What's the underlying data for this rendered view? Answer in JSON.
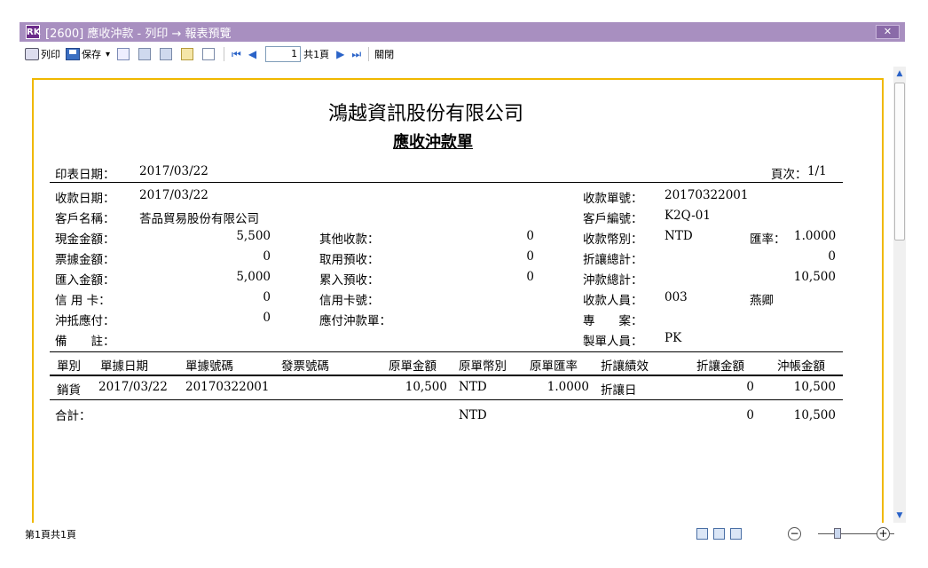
{
  "window": {
    "logo": "RK",
    "title": "[2600] 應收沖款 - 列印 → 報表預覽",
    "close": "✕"
  },
  "toolbar": {
    "print": "列印",
    "save": "保存",
    "save_dropdown": "▾",
    "first": "⏮",
    "prev": "◀",
    "page": "1",
    "page_total": "共1頁",
    "next": "▶",
    "last": "⏭",
    "close": "關閉"
  },
  "report": {
    "company": "鴻越資訊股份有限公司",
    "title": "應收沖款單",
    "print_date_label": "印表日期：",
    "print_date": "2017/03/22",
    "page_label": "頁次：",
    "page": "1/1",
    "fields": {
      "receipt_date_label": "收款日期：",
      "receipt_date": "2017/03/22",
      "receipt_no_label": "收款單號：",
      "receipt_no": "20170322001",
      "customer_label": "客戶名稱：",
      "customer": "荅品貿易股份有限公司",
      "customer_no_label": "客戶編號：",
      "customer_no": "K2Q-01",
      "cash_label": "現金金額：",
      "cash": "5,500",
      "other_label": "其他收款：",
      "other": "0",
      "currency_label": "收款幣別：",
      "currency": "NTD",
      "rate_label": "匯率：",
      "rate": "1.0000",
      "bill_label": "票據金額：",
      "bill": "0",
      "prepay_used_label": "取用預收：",
      "prepay_used": "0",
      "discount_total_label": "折讓總計：",
      "discount_total": "0",
      "remit_label": "匯入金額：",
      "remit": "5,000",
      "prepay_in_label": "累入預收：",
      "prepay_in": "0",
      "offset_total_label": "沖款總計：",
      "offset_total": "10,500",
      "card_label": "信 用 卡：",
      "card": "0",
      "card_no_label": "信用卡號：",
      "collector_label": "收款人員：",
      "collector_id": "003",
      "collector_name": "燕卿",
      "payable_label": "沖抵應付：",
      "payable": "0",
      "payable_no_label": "應付沖款單：",
      "project_label": "專　　案：",
      "note_label": "備　　註：",
      "maker_label": "製單人員：",
      "maker": "PK"
    },
    "columns": [
      "單別",
      "單據日期",
      "單據號碼",
      "發票號碼",
      "原單金額",
      "原單幣別",
      "原單匯率",
      "折讓績效",
      "折讓金額",
      "沖帳金額"
    ],
    "rows": [
      {
        "type": "銷貨",
        "date": "2017/03/22",
        "doc_no": "20170322001",
        "invoice": "",
        "amount": "10,500",
        "currency": "NTD",
        "rate": "1.0000",
        "perf": "折讓日",
        "discount": "0",
        "offset": "10,500"
      }
    ],
    "total": {
      "label": "合計：",
      "currency": "NTD",
      "discount": "0",
      "offset": "10,500"
    }
  },
  "status": {
    "text": "第1頁共1頁",
    "zoom_minus": "−",
    "zoom_plus": "+"
  }
}
